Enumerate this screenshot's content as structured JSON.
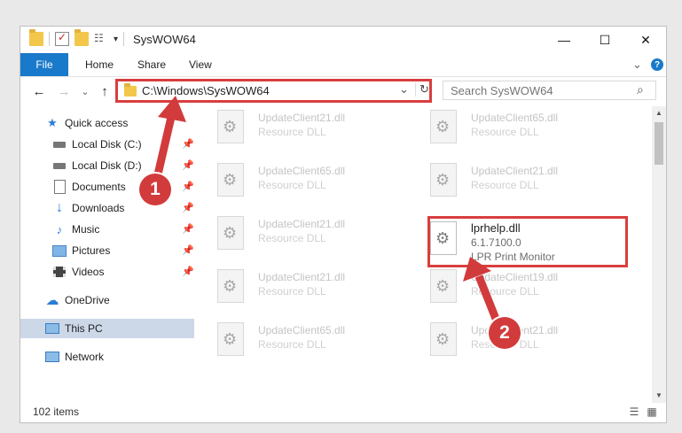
{
  "window": {
    "title": "SysWOW64",
    "controls": {
      "minimize": "—",
      "maximize": "☐",
      "close": "✕"
    }
  },
  "ribbon": {
    "tabs": [
      "File",
      "Home",
      "Share",
      "View"
    ],
    "expand_icon": "⌄",
    "help_icon": "?"
  },
  "address": {
    "path": "C:\\Windows\\SysWOW64",
    "dropdown": "⌄",
    "refresh": "↻",
    "search_placeholder": "Search SysWOW64",
    "search_icon": "⌕"
  },
  "nav_buttons": {
    "back": "←",
    "forward": "→",
    "recent": "⌄",
    "up": "↑"
  },
  "sidebar": {
    "items": [
      {
        "label": "Quick access",
        "icon": "star-icon"
      },
      {
        "label": "Local Disk (C:)",
        "icon": "drive-icon"
      },
      {
        "label": "Local Disk (D:)",
        "icon": "drive-icon"
      },
      {
        "label": "Documents",
        "icon": "documents-icon"
      },
      {
        "label": "Downloads",
        "icon": "downloads-icon"
      },
      {
        "label": "Music",
        "icon": "music-icon"
      },
      {
        "label": "Pictures",
        "icon": "pictures-icon"
      },
      {
        "label": "Videos",
        "icon": "videos-icon"
      },
      {
        "label": "OneDrive",
        "icon": "cloud-icon"
      },
      {
        "label": "This PC",
        "icon": "computer-icon"
      },
      {
        "label": "Network",
        "icon": "network-icon"
      }
    ]
  },
  "files": {
    "left_column": [
      {
        "name": "UpdateClient21.dll",
        "desc": "Resource DLL"
      },
      {
        "name": "UpdateClient65.dll",
        "desc": "Resource DLL"
      },
      {
        "name": "UpdateClient21.dll",
        "desc": "Resource DLL"
      },
      {
        "name": "UpdateClient21.dll",
        "desc": "Resource DLL"
      },
      {
        "name": "UpdateClient65.dll",
        "desc": "Resource DLL"
      }
    ],
    "right_column": [
      {
        "name": "UpdateClient65.dll",
        "desc": "Resource DLL"
      },
      {
        "name": "UpdateClient21.dll",
        "desc": "Resource DLL"
      },
      {
        "name": "lprhelp.dll",
        "desc": "6.1.7100.0",
        "desc2": "LPR Print Monitor"
      },
      {
        "name": "UpdateClient19.dll",
        "desc": "Resource DLL"
      },
      {
        "name": "UpdateClient21.dll",
        "desc": "Resource DLL"
      }
    ]
  },
  "status": {
    "item_count": "102 items"
  },
  "annotations": {
    "badge1": "1",
    "badge2": "2",
    "color": "#d23b3b"
  }
}
